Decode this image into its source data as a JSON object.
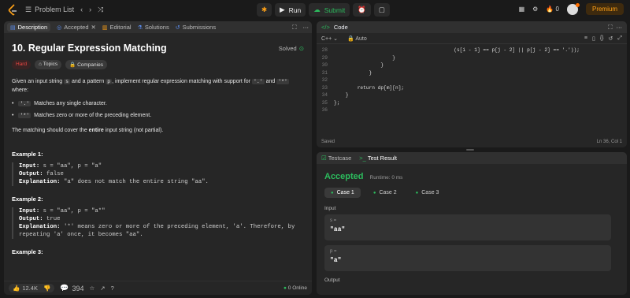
{
  "topbar": {
    "problem_list_label": "Problem List",
    "run_label": "Run",
    "submit_label": "Submit",
    "streak_count": "0",
    "premium_label": "Premium"
  },
  "left_tabs": [
    {
      "label": "Description"
    },
    {
      "label": "Accepted"
    },
    {
      "label": "Editorial"
    },
    {
      "label": "Solutions"
    },
    {
      "label": "Submissions"
    }
  ],
  "problem": {
    "title": "10. Regular Expression Matching",
    "solved_label": "Solved",
    "difficulty": "Hard",
    "topics_label": "Topics",
    "companies_label": "Companies",
    "intro_1": "Given an input string ",
    "intro_s": "s",
    "intro_2": " and a pattern ",
    "intro_p": "p",
    "intro_3": ", implement regular expression matching with support for ",
    "intro_dot": "'.'",
    "intro_4": " and ",
    "intro_star": "'*'",
    "intro_5": "where:",
    "bullet1_code": "'.'",
    "bullet1_text": "Matches any single character.",
    "bullet2_code": "'*'",
    "bullet2_text": "Matches zero or more of the preceding element.",
    "cover_1": "The matching should cover the ",
    "cover_bold": "entire",
    "cover_2": " input string (not partial).",
    "examples": [
      {
        "title": "Example 1:",
        "input": "s = \"aa\", p = \"a\"",
        "output": "false",
        "explanation": "\"a\" does not match the entire string \"aa\"."
      },
      {
        "title": "Example 2:",
        "input": "s = \"aa\", p = \"a*\"",
        "output": "true",
        "explanation_1": "'*' means zero or more of the preceding element, 'a'. Therefore, by",
        "explanation_2": "repeating 'a' once, it becomes \"aa\"."
      },
      {
        "title": "Example 3:"
      }
    ],
    "input_label": "Input:",
    "output_label": "Output:",
    "explanation_label": "Explanation:"
  },
  "bottombar": {
    "likes": "12.4K",
    "comments": "394",
    "online": "0 Online"
  },
  "code": {
    "title": "Code",
    "language": "C++",
    "auto_label": "Auto",
    "lines": [
      {
        "n": "28",
        "t": "                                         (s[i - 1] == p[j - 2] || p[j - 2] == '.'));"
      },
      {
        "n": "29",
        "t": "                    }"
      },
      {
        "n": "30",
        "t": "                }"
      },
      {
        "n": "31",
        "t": "            }"
      },
      {
        "n": "32",
        "t": ""
      },
      {
        "n": "33",
        "t": "        return dp[m][n];"
      },
      {
        "n": "34",
        "t": "    }"
      },
      {
        "n": "35",
        "t": "};"
      },
      {
        "n": "36",
        "t": ""
      }
    ],
    "saved_label": "Saved",
    "cursor": "Ln 36, Col 1"
  },
  "test": {
    "tab_testcase": "Testcase",
    "tab_result": "Test Result",
    "status": "Accepted",
    "runtime": "Runtime: 0 ms",
    "cases": [
      {
        "label": "Case 1"
      },
      {
        "label": "Case 2"
      },
      {
        "label": "Case 3"
      }
    ],
    "input_label": "Input",
    "var_s_label": "s =",
    "var_s_value": "\"aa\"",
    "var_p_label": "p =",
    "var_p_value": "\"a\"",
    "output_label": "Output"
  },
  "colors": {
    "accent_green": "#2cbb5d",
    "hard_red": "#ef4743",
    "premium": "#ffa116"
  }
}
